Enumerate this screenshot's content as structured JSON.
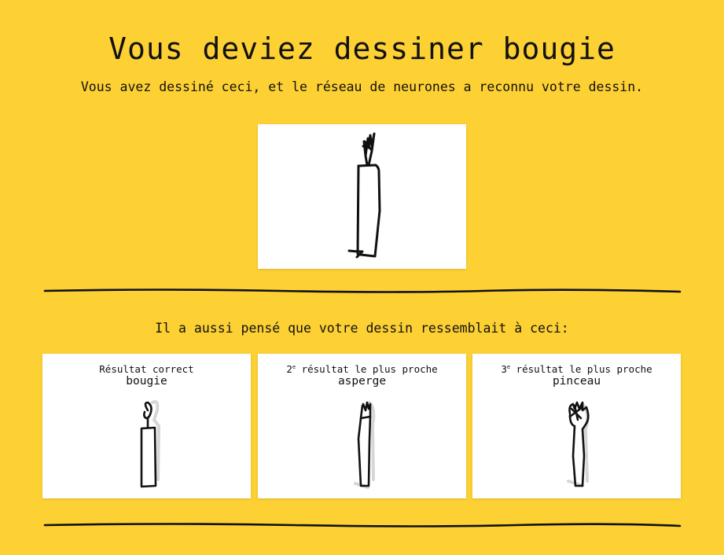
{
  "header": {
    "title": "Vous deviez dessiner bougie",
    "subtitle": "Vous avez dessiné ceci, et le réseau de neurones a reconnu votre dessin."
  },
  "user_drawing": {
    "label": "bougie"
  },
  "similar": {
    "label": "Il a aussi pensé que votre dessin ressemblait à ceci:",
    "results": [
      {
        "prefix": "Résultat correct",
        "superscript": "",
        "caption_rest": "",
        "word": "bougie"
      },
      {
        "prefix": "2",
        "superscript": "e",
        "caption_rest": " résultat le plus proche",
        "word": "asperge"
      },
      {
        "prefix": "3",
        "superscript": "e",
        "caption_rest": " résultat le plus proche",
        "word": "pinceau"
      }
    ]
  },
  "colors": {
    "background": "#fdd034",
    "card": "#ffffff",
    "ink": "#111111",
    "ghost_ink": "#d4d4d4"
  }
}
